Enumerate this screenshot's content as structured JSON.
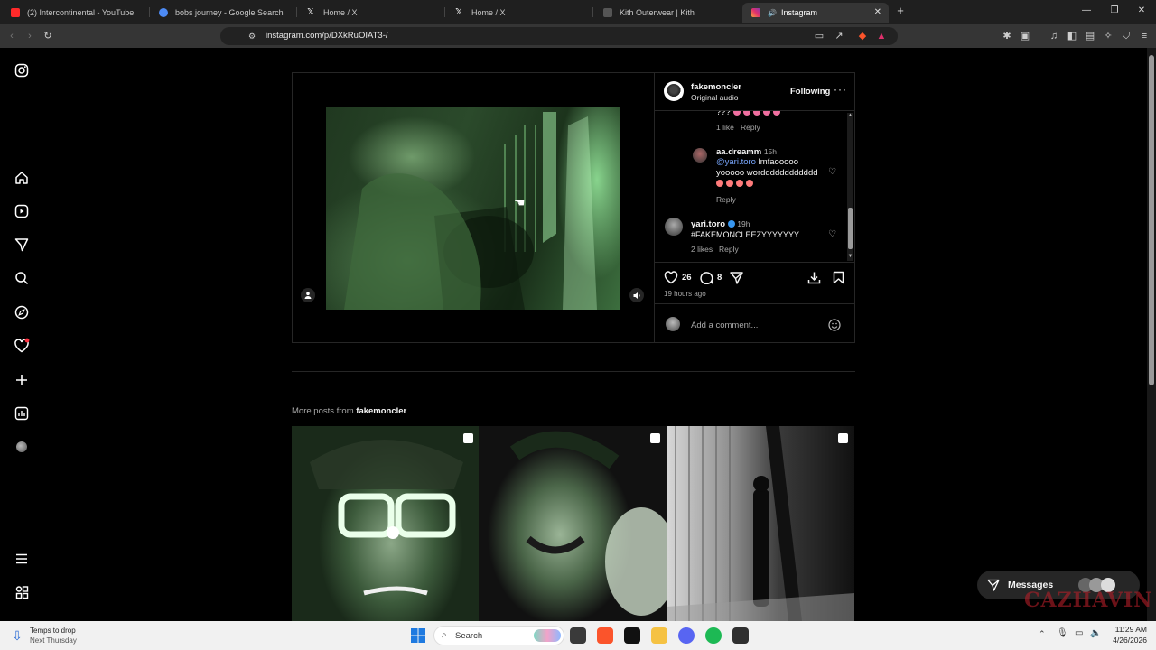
{
  "browser": {
    "tabs": [
      {
        "title": "(2) Intercontinental - YouTube",
        "color": "#ff2a2a"
      },
      {
        "title": "bobs journey - Google Search",
        "color": "#4d8bf5"
      },
      {
        "title": "Home / X",
        "color": "#ffffff"
      },
      {
        "title": "Home / X",
        "color": "#ffffff"
      },
      {
        "title": "Kith Outerwear | Kith",
        "color": "#333333"
      },
      {
        "title": "Instagram",
        "color": "#e1306c"
      }
    ],
    "url": "instagram.com/p/DXkRuOIAT3-/"
  },
  "post": {
    "username": "fakemoncler",
    "audio": "Original audio",
    "follow_label": "Following",
    "likes": "26",
    "comments_count": "8",
    "time_ago": "19 hours ago",
    "add_comment_placeholder": "Add a comment...",
    "comments": [
      {
        "text_top": "???",
        "likes": "1 like",
        "reply": "Reply"
      },
      {
        "user": "aa.dreamm",
        "time": "15h",
        "mention": "@yari.toro",
        "text1": "lmfaooooo",
        "text2": "yooooo wordddddddddddd",
        "reply": "Reply"
      },
      {
        "user": "yari.toro",
        "time": "19h",
        "hashtag": "#FAKEMONCLEEZYYYYYYY",
        "likes": "2 likes",
        "reply": "Reply"
      }
    ]
  },
  "more_posts": {
    "prefix": "More posts from",
    "user": "fakemoncler"
  },
  "messages_label": "Messages",
  "taskbar": {
    "weather_title": "Temps to drop",
    "weather_sub": "Next Thursday",
    "search": "Search",
    "time": "11:29 AM",
    "date": "4/26/2026"
  },
  "watermark": "CAZHAVIN"
}
